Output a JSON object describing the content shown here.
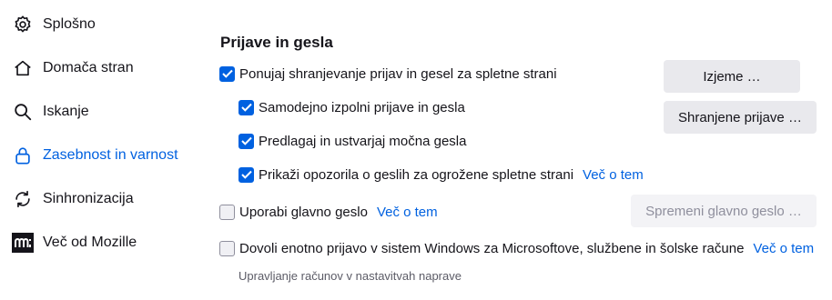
{
  "sidebar": {
    "items": [
      {
        "label": "Splošno",
        "icon": "gear-icon",
        "selected": false
      },
      {
        "label": "Domača stran",
        "icon": "home-icon",
        "selected": false
      },
      {
        "label": "Iskanje",
        "icon": "search-icon",
        "selected": false
      },
      {
        "label": "Zasebnost in varnost",
        "icon": "lock-icon",
        "selected": true
      },
      {
        "label": "Sinhronizacija",
        "icon": "sync-icon",
        "selected": false
      },
      {
        "label": "Več od Mozille",
        "icon": "mozilla-logo-icon",
        "selected": false
      }
    ]
  },
  "logins": {
    "title": "Prijave in gesla",
    "offer_save": {
      "label": "Ponujaj shranjevanje prijav in gesel za spletne strani",
      "checked": true
    },
    "autofill": {
      "label": "Samodejno izpolni prijave in gesla",
      "checked": true
    },
    "suggest": {
      "label": "Predlagaj in ustvarjaj močna gesla",
      "checked": true
    },
    "breach_alerts": {
      "label": "Prikaži opozorila o geslih za ogrožene spletne strani",
      "checked": true,
      "link": "Več o tem"
    },
    "primary_password": {
      "label": "Uporabi glavno geslo",
      "checked": false,
      "link": "Več o tem"
    },
    "windows_sso": {
      "label": "Dovoli enotno prijavo v sistem Windows za Microsoftove, službene in šolske račune",
      "checked": false,
      "link": "Več o tem"
    },
    "sso_hint": "Upravljanje računov v nastavitvah naprave",
    "buttons": {
      "exceptions": "Izjeme …",
      "saved_logins": "Shranjene prijave …",
      "change_primary": "Spremeni glavno geslo …"
    }
  },
  "colors": {
    "accent": "#0061e0",
    "button_bg": "#e9e9ed",
    "text": "#15141a",
    "muted": "#5b5b66"
  }
}
